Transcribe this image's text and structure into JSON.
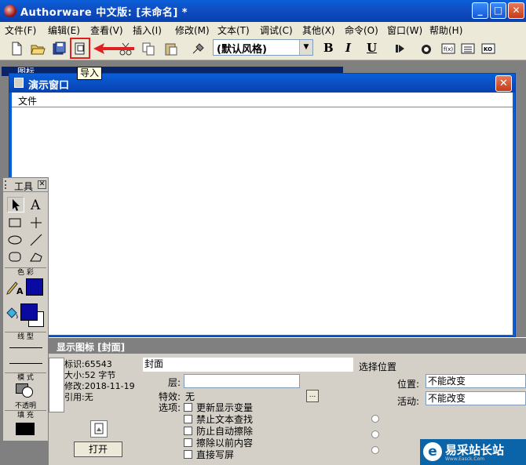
{
  "app": {
    "title": "Authorware 中文版: [未命名] *"
  },
  "menu": [
    "文件(F)",
    "编辑(E)",
    "查看(V)",
    "插入(I)",
    "修改(M)",
    "文本(T)",
    "调试(C)",
    "其他(X)",
    "命令(O)",
    "窗口(W)",
    "帮助(H)"
  ],
  "toolbar": {
    "style_value": "(默认风格)",
    "bold": "B",
    "italic": "I",
    "underline": "U",
    "tooltip": "导入"
  },
  "presentation": {
    "title": "演示窗口",
    "menu_file": "文件"
  },
  "tools_panel": {
    "title": "工具",
    "color_label": "色 彩",
    "line_label": "线 型",
    "mode_label": "模 式",
    "mode_value": "不透明",
    "fill_label": "填 充",
    "accent_color": "#0a0aa0"
  },
  "props": {
    "header": "显示图标 [封面]",
    "id_label": "标识:",
    "id_value": "65543",
    "size_label": "大小:",
    "size_value": "52 字节",
    "modified_label": "修改:",
    "modified_value": "2018-11-19",
    "ref_label": "引用:",
    "ref_value": "无",
    "open_button": "打开",
    "name_value": "封面",
    "layer_label": "层:",
    "layer_value": "",
    "effect_label": "特效:",
    "effect_value": "无",
    "browse": "...",
    "options_label": "选项:",
    "options": [
      "更新显示变量",
      "禁止文本查找",
      "防止自动擦除",
      "擦除以前内容",
      "直接写屏"
    ],
    "select_position": "选择位置",
    "position_label": "位置:",
    "position_value": "不能改变",
    "active_label": "活动:",
    "active_value": "不能改变"
  },
  "watermark": {
    "text": "易采站长站",
    "url": "Www.Easck.Com"
  }
}
